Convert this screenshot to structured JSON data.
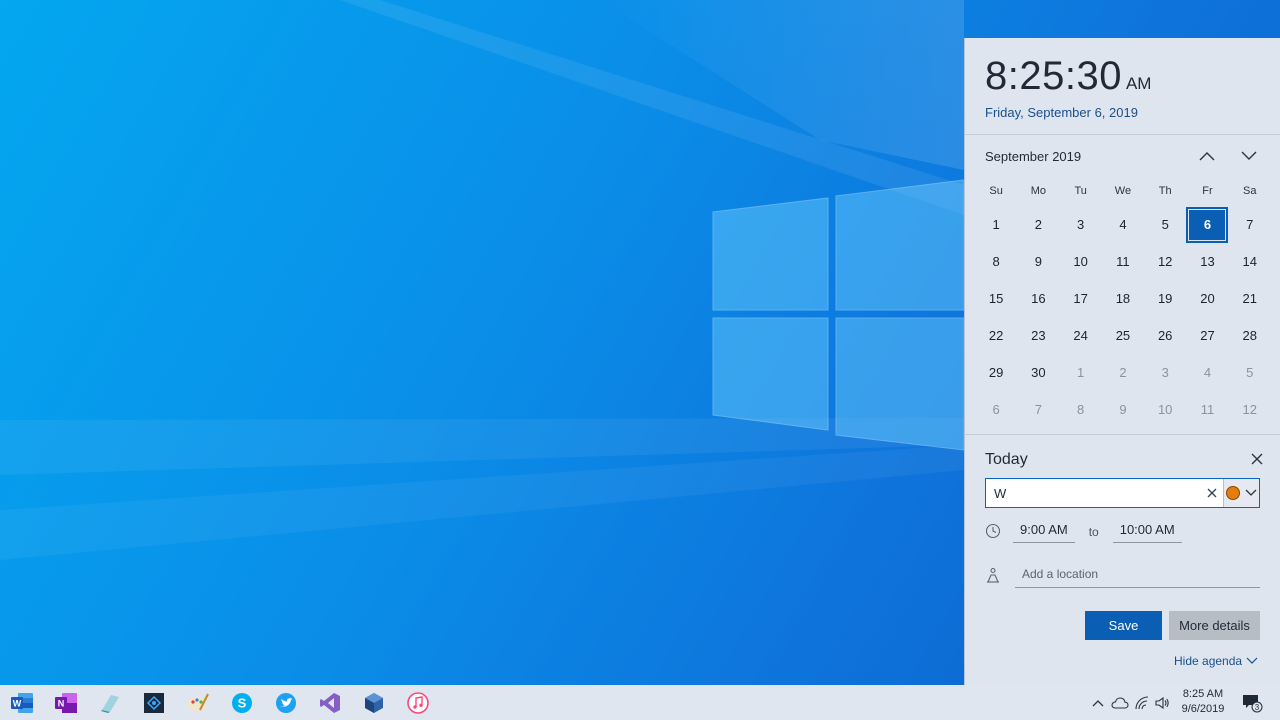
{
  "clock": {
    "time": "8:25:30",
    "ampm": "AM",
    "date": "Friday, September 6, 2019"
  },
  "calendar": {
    "month_label": "September 2019",
    "weekdays": [
      "Su",
      "Mo",
      "Tu",
      "We",
      "Th",
      "Fr",
      "Sa"
    ],
    "weeks": [
      [
        "1",
        "2",
        "3",
        "4",
        "5",
        "6",
        "7"
      ],
      [
        "8",
        "9",
        "10",
        "11",
        "12",
        "13",
        "14"
      ],
      [
        "15",
        "16",
        "17",
        "18",
        "19",
        "20",
        "21"
      ],
      [
        "22",
        "23",
        "24",
        "25",
        "26",
        "27",
        "28"
      ],
      [
        "29",
        "30",
        "1",
        "2",
        "3",
        "4",
        "5"
      ],
      [
        "6",
        "7",
        "8",
        "9",
        "10",
        "11",
        "12"
      ]
    ],
    "today": "6"
  },
  "agenda": {
    "title": "Today",
    "event_value": "W",
    "start_time": "9:00 AM",
    "to_label": "to",
    "end_time": "10:00 AM",
    "location_placeholder": "Add a location",
    "save_label": "Save",
    "more_details_label": "More details",
    "hide_agenda_label": "Hide agenda"
  },
  "taskbar": {
    "apps": [
      "word-icon",
      "onenote-icon",
      "notes-icon",
      "app-icon",
      "paint-icon",
      "skype-icon",
      "twitter-icon",
      "visual-studio-icon",
      "virtualbox-icon",
      "itunes-icon"
    ],
    "clock_time": "8:25 AM",
    "clock_date": "9/6/2019",
    "notification_count": "3"
  },
  "colors": {
    "accent": "#0a5fb4",
    "event_color": "#e47c0e",
    "panel_bg": "#dfe5ef"
  }
}
